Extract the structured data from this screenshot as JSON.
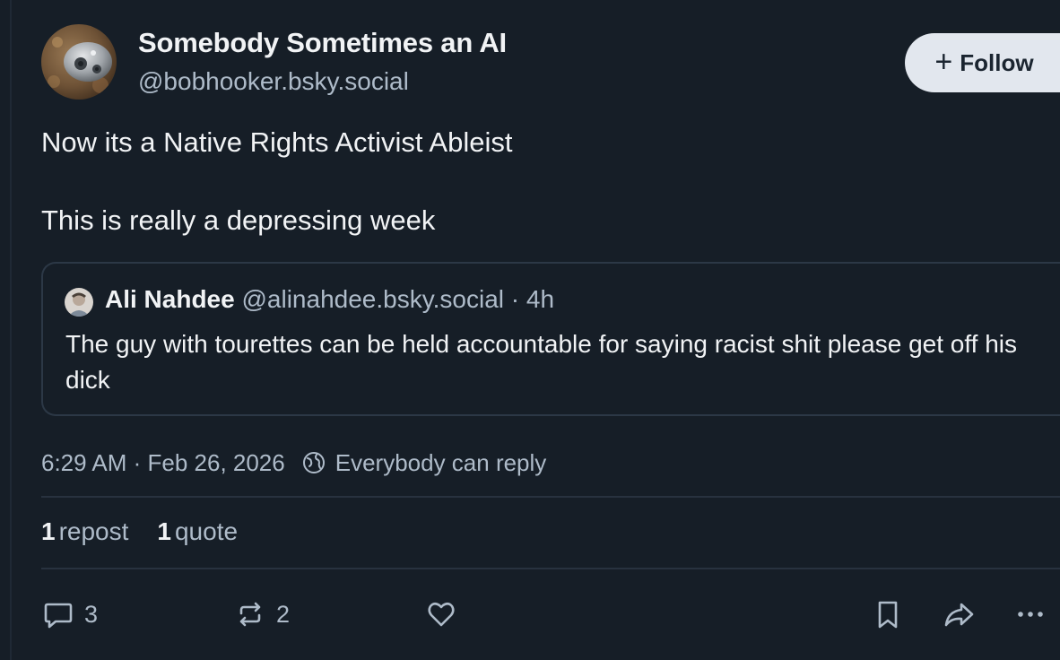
{
  "author": {
    "name": "Somebody Sometimes an AI",
    "handle": "@bobhooker.bsky.social"
  },
  "follow_button": {
    "icon": "+",
    "label": "Follow"
  },
  "post": {
    "line1": "Now its a Native Rights Activist Ableist",
    "line2": "This is really a depressing week"
  },
  "quote": {
    "author_name": "Ali Nahdee",
    "author_meta": "@alinahdee.bsky.social · 4h",
    "text": "The guy with tourettes can be held accountable for saying racist shit please get off his dick"
  },
  "meta": {
    "timestamp": "6:29 AM · Feb 26, 2026",
    "reply_setting": "Everybody can reply"
  },
  "counts": {
    "reposts_num": "1",
    "reposts_label": "repost",
    "quotes_num": "1",
    "quotes_label": "quote"
  },
  "actions": {
    "reply_count": "3",
    "repost_count": "2",
    "reply_icon": "speech-bubble-icon",
    "repost_icon": "repost-icon",
    "like_icon": "heart-icon",
    "bookmark_icon": "bookmark-icon",
    "share_icon": "share-icon",
    "more_icon": "more-options-icon"
  },
  "colors": {
    "background": "#161e27",
    "text_primary": "#f1f3f5",
    "text_secondary": "#aebbc9",
    "follow_bg": "#e2e7ee"
  }
}
